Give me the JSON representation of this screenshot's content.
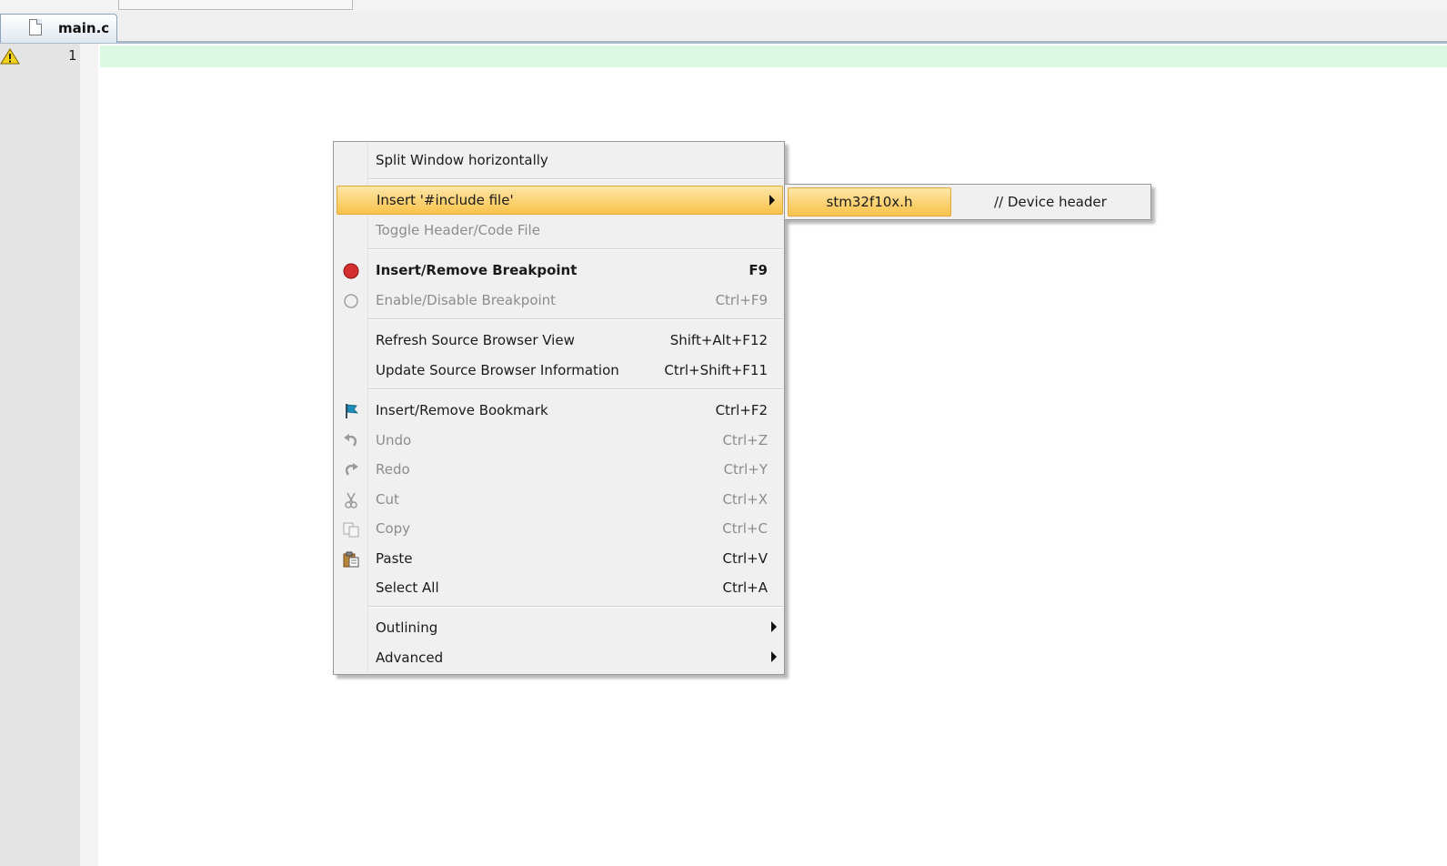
{
  "editor": {
    "tab": {
      "label": "main.c",
      "icon": "document-icon"
    },
    "line_numbers": [
      "1"
    ],
    "gutter_icon": "warning-icon",
    "current_line_color": "#dcfae3"
  },
  "context_menu": {
    "items": [
      {
        "label": "Split Window horizontally",
        "shortcut": "",
        "state": "enabled"
      },
      {
        "label": "Insert '#include file'",
        "shortcut": "",
        "state": "highlighted",
        "submenu": true
      },
      {
        "label": "Toggle Header/Code File",
        "shortcut": "",
        "state": "disabled"
      },
      {
        "label": "Insert/Remove Breakpoint",
        "shortcut": "F9",
        "state": "bold",
        "icon": "breakpoint-icon"
      },
      {
        "label": "Enable/Disable Breakpoint",
        "shortcut": "Ctrl+F9",
        "state": "disabled",
        "icon": "breakpoint-outline-icon"
      },
      {
        "label": "Refresh Source Browser View",
        "shortcut": "Shift+Alt+F12",
        "state": "enabled"
      },
      {
        "label": "Update Source Browser Information",
        "shortcut": "Ctrl+Shift+F11",
        "state": "enabled"
      },
      {
        "label": "Insert/Remove Bookmark",
        "shortcut": "Ctrl+F2",
        "state": "enabled",
        "icon": "bookmark-flag-icon"
      },
      {
        "label": "Undo",
        "shortcut": "Ctrl+Z",
        "state": "disabled",
        "icon": "undo-icon"
      },
      {
        "label": "Redo",
        "shortcut": "Ctrl+Y",
        "state": "disabled",
        "icon": "redo-icon"
      },
      {
        "label": "Cut",
        "shortcut": "Ctrl+X",
        "state": "disabled",
        "icon": "scissors-icon"
      },
      {
        "label": "Copy",
        "shortcut": "Ctrl+C",
        "state": "disabled",
        "icon": "copy-icon"
      },
      {
        "label": "Paste",
        "shortcut": "Ctrl+V",
        "state": "enabled",
        "icon": "paste-icon"
      },
      {
        "label": "Select All",
        "shortcut": "Ctrl+A",
        "state": "enabled"
      },
      {
        "label": "Outlining",
        "shortcut": "",
        "state": "enabled",
        "submenu": true
      },
      {
        "label": "Advanced",
        "shortcut": "",
        "state": "enabled",
        "submenu": true
      }
    ]
  },
  "include_submenu": {
    "file": "stm32f10x.h",
    "comment": "// Device header"
  },
  "colors": {
    "highlight_top": "#fde6a6",
    "highlight_bottom": "#f8c24a",
    "breakpoint_red": "#d32f2f",
    "disabled_text": "#8c8c8c"
  }
}
